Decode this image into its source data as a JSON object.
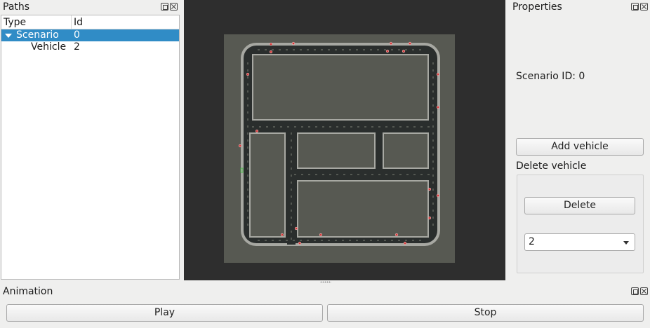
{
  "paths": {
    "title": "Paths",
    "columns": {
      "type": "Type",
      "id": "Id"
    },
    "rows": [
      {
        "type": "Scenario",
        "id": "0",
        "expanded": true,
        "selected": true
      },
      {
        "type": "Vehicle",
        "id": "2",
        "expanded": false,
        "selected": false
      }
    ]
  },
  "properties": {
    "title": "Properties",
    "scenario_id_text": "Scenario ID: 0",
    "add_vehicle_label": "Add vehicle",
    "delete_group_label": "Delete vehicle",
    "delete_label": "Delete",
    "vehicle_select_value": "2"
  },
  "animation": {
    "title": "Animation",
    "play_label": "Play",
    "stop_label": "Stop"
  },
  "icons": {
    "float": "float-icon",
    "close": "close-icon",
    "expand": "triangle-down-icon",
    "dropdown": "chevron-down-icon"
  },
  "colors": {
    "selection": "#308cc6",
    "viewport_bg": "#2e2e2e",
    "map_ground": "#575952",
    "road": "#2a2e2d",
    "curb": "#a7a8a2",
    "car_marker": "#d03a3a"
  }
}
